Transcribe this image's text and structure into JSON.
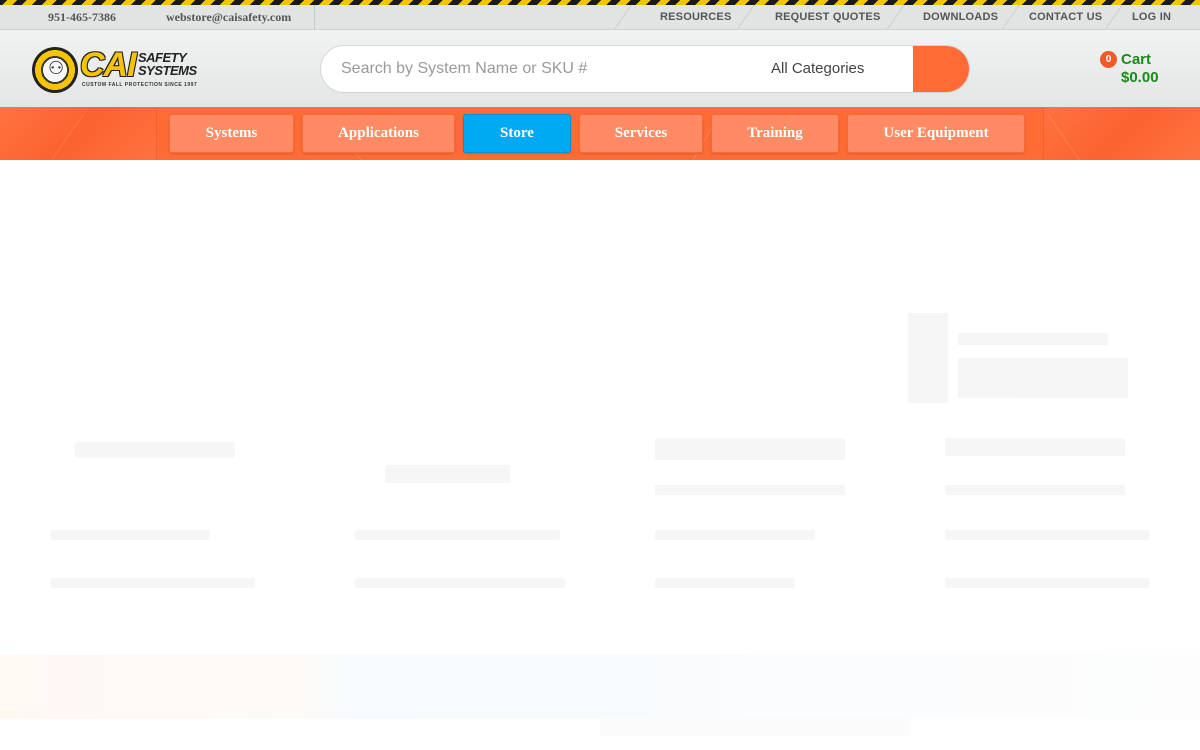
{
  "topbar": {
    "phone": "951-465-7386",
    "email": "webstore@caisafety.com",
    "links": [
      {
        "label": "RESOURCES"
      },
      {
        "label": "REQUEST QUOTES"
      },
      {
        "label": "DOWNLOADS"
      },
      {
        "label": "CONTACT US"
      },
      {
        "label": "LOG IN"
      }
    ]
  },
  "header": {
    "logo": {
      "brand_main": "CAI",
      "brand_line1": "SAFETY",
      "brand_line2": "SYSTEMS",
      "tagline": "CUSTOM FALL PROTECTION SINCE 1997"
    },
    "search": {
      "placeholder": "Search by System Name or SKU #",
      "category": "All Categories"
    },
    "cart": {
      "count": "0",
      "label": "Cart",
      "total": "$0.00"
    }
  },
  "nav": {
    "items": [
      {
        "label": "Systems"
      },
      {
        "label": "Applications"
      },
      {
        "label": "Store"
      },
      {
        "label": "Services"
      },
      {
        "label": "Training"
      },
      {
        "label": "User Equipment"
      }
    ],
    "active": "Store"
  },
  "colors": {
    "accent_orange": "#ff6b35",
    "active_blue": "#00aaf2",
    "cart_green": "#1a8a1a",
    "hazard_yellow": "#f5c400"
  }
}
